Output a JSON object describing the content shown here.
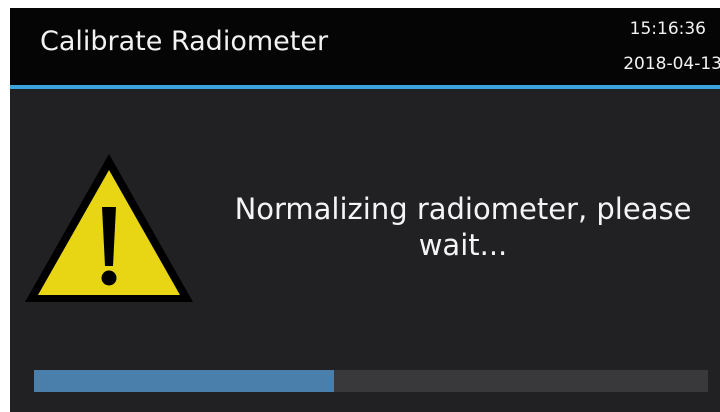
{
  "header": {
    "title": "Calibrate Radiometer",
    "time": "15:16:36",
    "date": "2018-04-13"
  },
  "main": {
    "icon": "warning-triangle-icon",
    "message": "Normalizing radiometer, please wait..."
  },
  "progress": {
    "fraction": 0.445
  },
  "colors": {
    "accent_line": "#3aa3dc",
    "progress_fill": "#4a7fab",
    "warning_fill": "#e8d615"
  }
}
